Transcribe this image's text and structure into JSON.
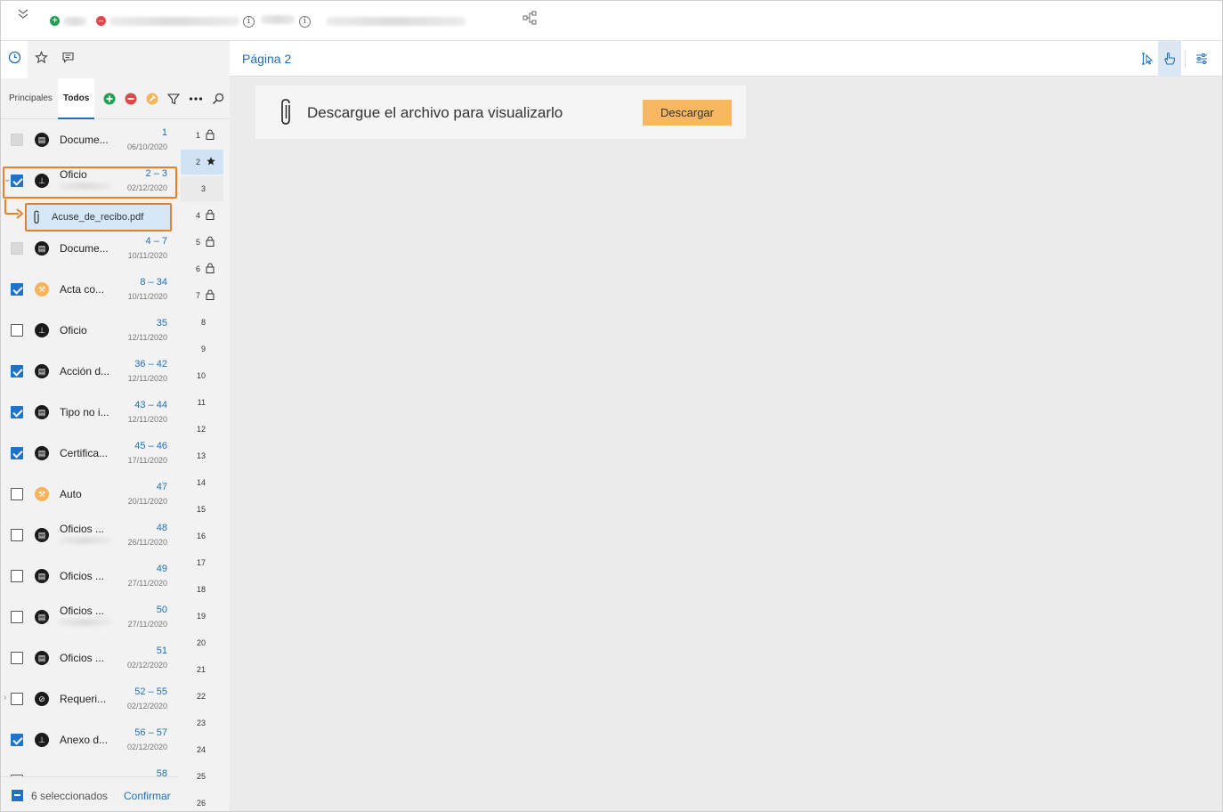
{
  "content": {
    "page_title": "Página 2",
    "message": "Descargue el archivo para visualizarlo",
    "download_label": "Descargar"
  },
  "left_panel": {
    "tabs": {
      "principales": "Principales",
      "todos": "Todos"
    },
    "attachment": {
      "name": "Acuse_de_recibo.pdf"
    },
    "rows": [
      {
        "name": "Docume...",
        "pages": "1",
        "date": "06/10/2020",
        "check": "disabled",
        "icon": "document-icon",
        "icon_color": "#1b1b1b"
      },
      {
        "name": "Oficio",
        "pages": "2 – 3",
        "date": "02/12/2020",
        "check": "checked",
        "icon": "stamp-icon",
        "icon_color": "#1b1b1b"
      },
      {
        "name": "Docume...",
        "pages": "4 – 7",
        "date": "10/11/2020",
        "check": "disabled",
        "icon": "document-icon",
        "icon_color": "#1b1b1b"
      },
      {
        "name": "Acta co...",
        "pages": "8 – 34",
        "date": "10/11/2020",
        "check": "checked",
        "icon": "gavel-icon",
        "icon_color": "#f6b35a"
      },
      {
        "name": "Oficio",
        "pages": "35",
        "date": "12/11/2020",
        "check": "unchecked",
        "icon": "stamp-icon",
        "icon_color": "#1b1b1b"
      },
      {
        "name": "Acción d...",
        "pages": "36 – 42",
        "date": "12/11/2020",
        "check": "checked",
        "icon": "document-icon",
        "icon_color": "#1b1b1b"
      },
      {
        "name": "Tipo no i...",
        "pages": "43 – 44",
        "date": "12/11/2020",
        "check": "checked",
        "icon": "document-icon",
        "icon_color": "#1b1b1b"
      },
      {
        "name": "Certifica...",
        "pages": "45 – 46",
        "date": "17/11/2020",
        "check": "checked",
        "icon": "document-icon",
        "icon_color": "#1b1b1b"
      },
      {
        "name": "Auto",
        "pages": "47",
        "date": "20/11/2020",
        "check": "unchecked",
        "icon": "gavel-icon",
        "icon_color": "#f6b35a"
      },
      {
        "name": "Oficios ...",
        "pages": "48",
        "date": "26/11/2020",
        "check": "unchecked",
        "icon": "document-icon",
        "icon_color": "#1b1b1b"
      },
      {
        "name": "Oficios ...",
        "pages": "49",
        "date": "27/11/2020",
        "check": "unchecked",
        "icon": "document-icon",
        "icon_color": "#1b1b1b"
      },
      {
        "name": "Oficios ...",
        "pages": "50",
        "date": "27/11/2020",
        "check": "unchecked",
        "icon": "document-icon",
        "icon_color": "#1b1b1b"
      },
      {
        "name": "Oficios ...",
        "pages": "51",
        "date": "02/12/2020",
        "check": "unchecked",
        "icon": "document-icon",
        "icon_color": "#1b1b1b"
      },
      {
        "name": "Requeri...",
        "pages": "52 – 55",
        "date": "02/12/2020",
        "check": "unchecked",
        "icon": "request-icon",
        "icon_color": "#1b1b1b"
      },
      {
        "name": "Anexo d...",
        "pages": "56 – 57",
        "date": "02/12/2020",
        "check": "checked",
        "icon": "stamp-icon",
        "icon_color": "#1b1b1b"
      },
      {
        "name": "",
        "pages": "58",
        "date": "",
        "check": "unchecked",
        "icon": "",
        "icon_color": "#1b1b1b"
      }
    ],
    "page_numbers": [
      {
        "n": "1",
        "lock": true
      },
      {
        "n": "2",
        "star": true,
        "selected": true
      },
      {
        "n": "3"
      },
      {
        "n": "4",
        "lock": true
      },
      {
        "n": "5",
        "lock": true
      },
      {
        "n": "6",
        "lock": true
      },
      {
        "n": "7",
        "lock": true
      },
      {
        "n": "8"
      },
      {
        "n": "9"
      },
      {
        "n": "10"
      },
      {
        "n": "11"
      },
      {
        "n": "12"
      },
      {
        "n": "13"
      },
      {
        "n": "14"
      },
      {
        "n": "15"
      },
      {
        "n": "16"
      },
      {
        "n": "17"
      },
      {
        "n": "18"
      },
      {
        "n": "19"
      },
      {
        "n": "20"
      },
      {
        "n": "21"
      },
      {
        "n": "22"
      },
      {
        "n": "23"
      },
      {
        "n": "24"
      },
      {
        "n": "25"
      },
      {
        "n": "26"
      }
    ],
    "footer": {
      "selected_count": "6 seleccionados",
      "confirm_label": "Confirmar"
    }
  },
  "colors": {
    "accent": "#1e6fba",
    "highlight": "#e1832e",
    "download_button": "#f7b660"
  }
}
